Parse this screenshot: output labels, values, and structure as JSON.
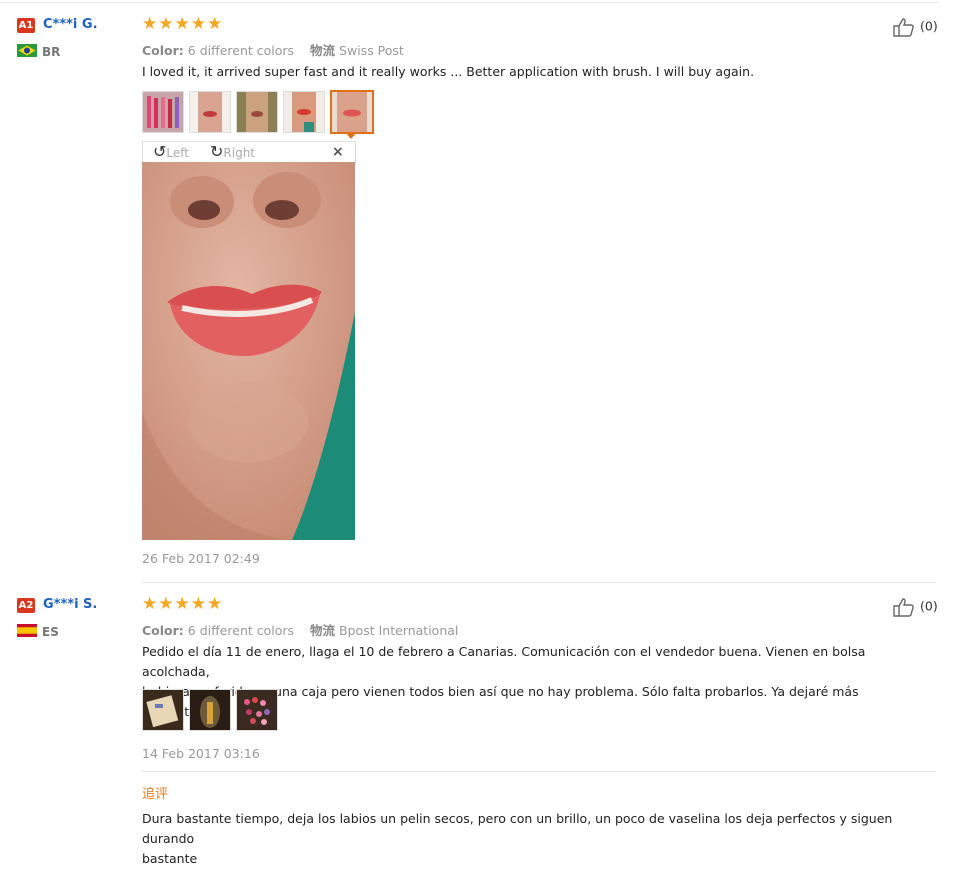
{
  "reviews": [
    {
      "level": "A1",
      "user": "C***i G.",
      "country": "BR",
      "stars": "★★★★★",
      "color_label": "Color:",
      "color_value": "6 different colors",
      "ship_label": "物流",
      "ship_value": "Swiss Post",
      "text": "I loved it, it arrived super fast and it really works ... Better application with brush. I will buy again.",
      "likes": "(0)",
      "date": "26 Feb 2017 02:49",
      "viewer": {
        "left": "Left",
        "right": "Right",
        "close": "×"
      }
    },
    {
      "level": "A2",
      "user": "G***i S.",
      "country": "ES",
      "stars": "★★★★★",
      "color_label": "Color:",
      "color_value": "6 different colors",
      "ship_label": "物流",
      "ship_value": "Bpost International",
      "text_line1": "Pedido el día 11 de enero, llaga el 10 de febrero a Canarias. Comunicación con el vendedor buena. Vienen en bolsa acolchada,",
      "text_line2": "hubiera preferido en una caja pero vienen todos bien así que no hay problema. Sólo falta probarlos. Ya dejaré más comentarios.",
      "likes": "(0)",
      "date": "14 Feb 2017 03:16",
      "followup_title": "追评",
      "followup_line1": "Dura bastante tiempo, deja los labios un pelin secos, pero con un brillo, un poco de vaselina los deja perfectos y siguen durando",
      "followup_line2": "bastante"
    }
  ],
  "colors": {
    "accent": "#f07a1a",
    "star": "#f5a623",
    "name": "#1b62c2",
    "level": "#d9381e"
  }
}
